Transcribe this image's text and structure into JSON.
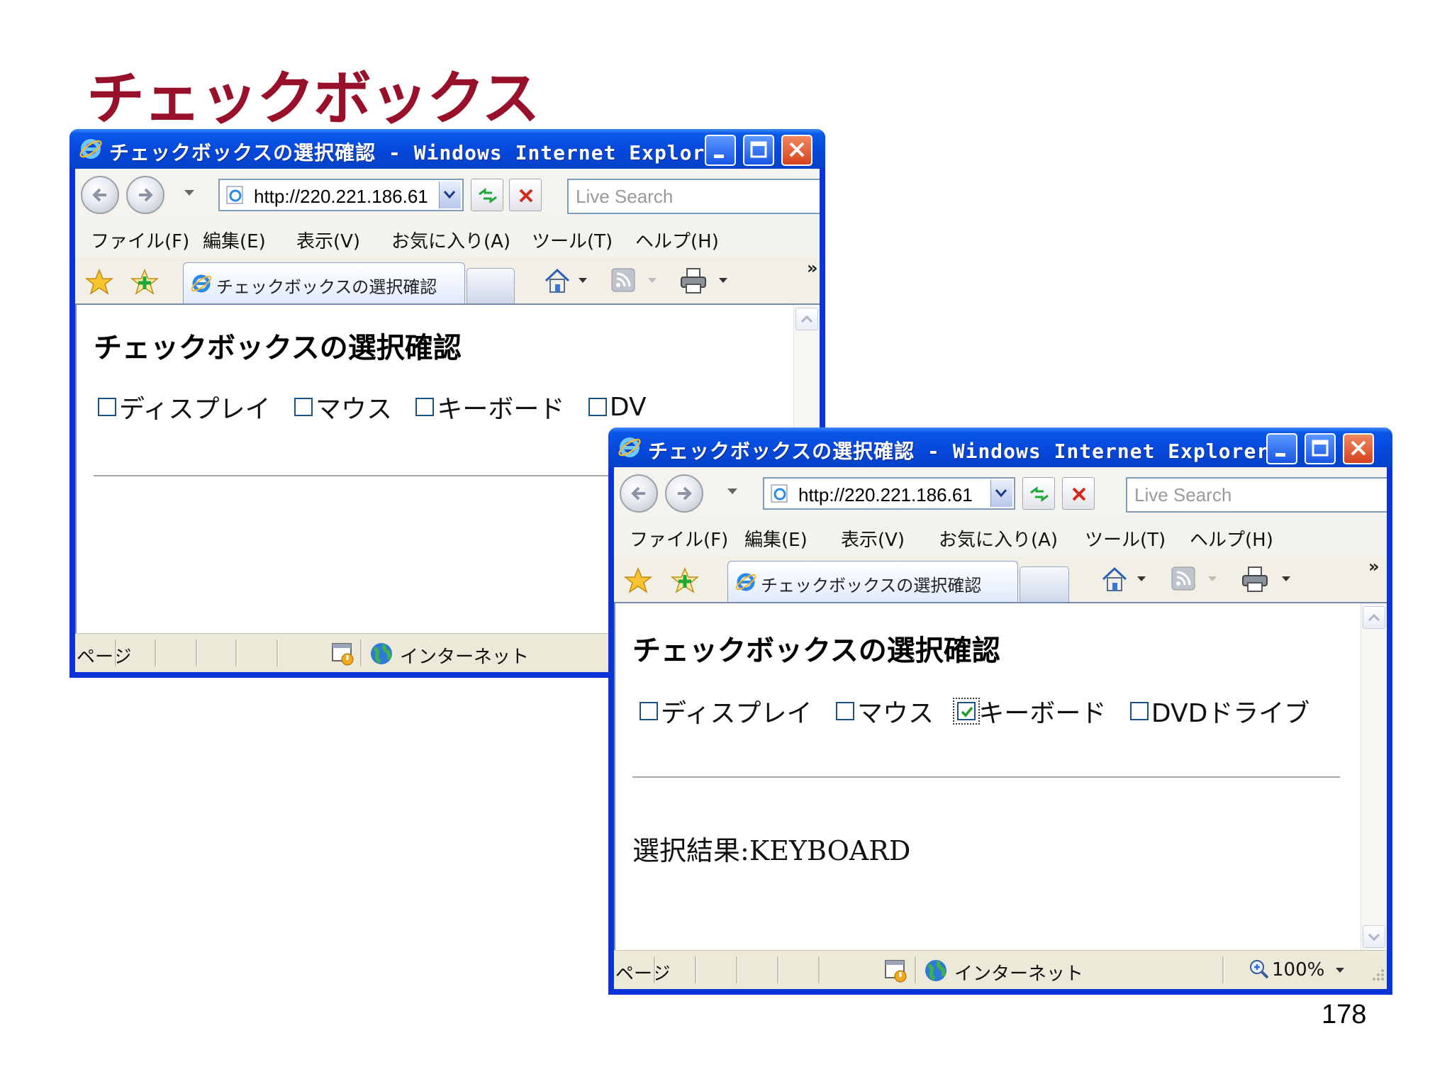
{
  "slide": {
    "title": "チェックボックス",
    "page_number": "178"
  },
  "browser": {
    "window_title": "チェックボックスの選択確認 - Windows Internet Explorer",
    "address": "http://220.221.186.61",
    "search_placeholder": "Live Search",
    "menu": [
      "ファイル(F)",
      "編集(E)",
      "表示(V)",
      "お気に入り(A)",
      "ツール(T)",
      "ヘルプ(H)"
    ],
    "tab_title": "チェックボックスの選択確認",
    "chevrons": "»",
    "status_page": "ページ",
    "zone": "インターネット",
    "zoom": "100%"
  },
  "page": {
    "heading": "チェックボックスの選択確認",
    "checkboxes": [
      {
        "label": "ディスプレイ",
        "checked": false
      },
      {
        "label": "マウス",
        "checked": false
      },
      {
        "label": "キーボード",
        "checked": true
      },
      {
        "label": "DVDドライブ",
        "checked": false
      }
    ],
    "result_label": "選択結果:",
    "result_value": "KEYBOARD",
    "before_submit_visible_last_label": "DV"
  },
  "colors": {
    "title_red": "#99102a",
    "xp_blue": "#0a58e8",
    "checkmark_green": "#1e9e2a"
  }
}
